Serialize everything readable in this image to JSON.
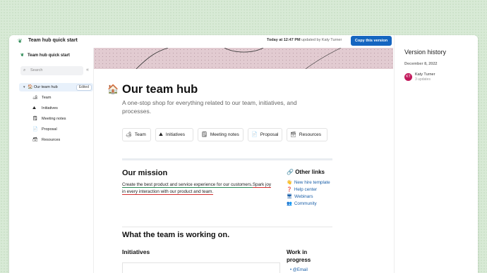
{
  "topbar": {
    "app_icon": "leaf-icon",
    "title": "Team hub quick start",
    "time": "Today at 12:47 PM",
    "updated_by": "updated by Katy Turner",
    "copy_button": "Copy this version"
  },
  "sidebar": {
    "title": "Team hub quick start",
    "search_placeholder": "Search",
    "collapse_icon": "double-chevron-left-icon",
    "items": [
      {
        "label": "Our team hub",
        "icon": "house-icon",
        "badge": "Edited",
        "active": true
      },
      {
        "label": "Team",
        "icon": "team-icon"
      },
      {
        "label": "Initiatives",
        "icon": "mountain-icon"
      },
      {
        "label": "Meeting notes",
        "icon": "notes-icon"
      },
      {
        "label": "Proposal",
        "icon": "document-icon"
      },
      {
        "label": "Resources",
        "icon": "box-icon"
      }
    ]
  },
  "page": {
    "icon": "house-icon",
    "title": "Our team hub",
    "subtitle": "A one-stop shop for everything related to our team, initiatives, and processes.",
    "nav_buttons": [
      "Team",
      "Initiatives",
      "Meeting notes",
      "Proposal",
      "Resources"
    ],
    "mission": {
      "heading": "Our mission",
      "text_1": "Create the best product and service experience for our customers.",
      "text_2": "Spark joy in every interaction with our product and team."
    },
    "other_links": {
      "heading": "Other links",
      "items": [
        "New hire template",
        "Help center",
        "Webinars",
        "Community"
      ]
    },
    "working_on": "What the team is working on.",
    "initiatives_heading": "Initiatives",
    "wip_heading": "Work in progress",
    "wip_items": [
      "@Email"
    ]
  },
  "history": {
    "title": "Version history",
    "date": "December 8, 2022",
    "author": "Katy Turner",
    "author_initials": "KT",
    "updates": "3 updates"
  },
  "colors": {
    "accent": "#1565c0",
    "banner": "#e2cbd1",
    "avatar": "#c2185b",
    "link": "#1a5fa8"
  }
}
